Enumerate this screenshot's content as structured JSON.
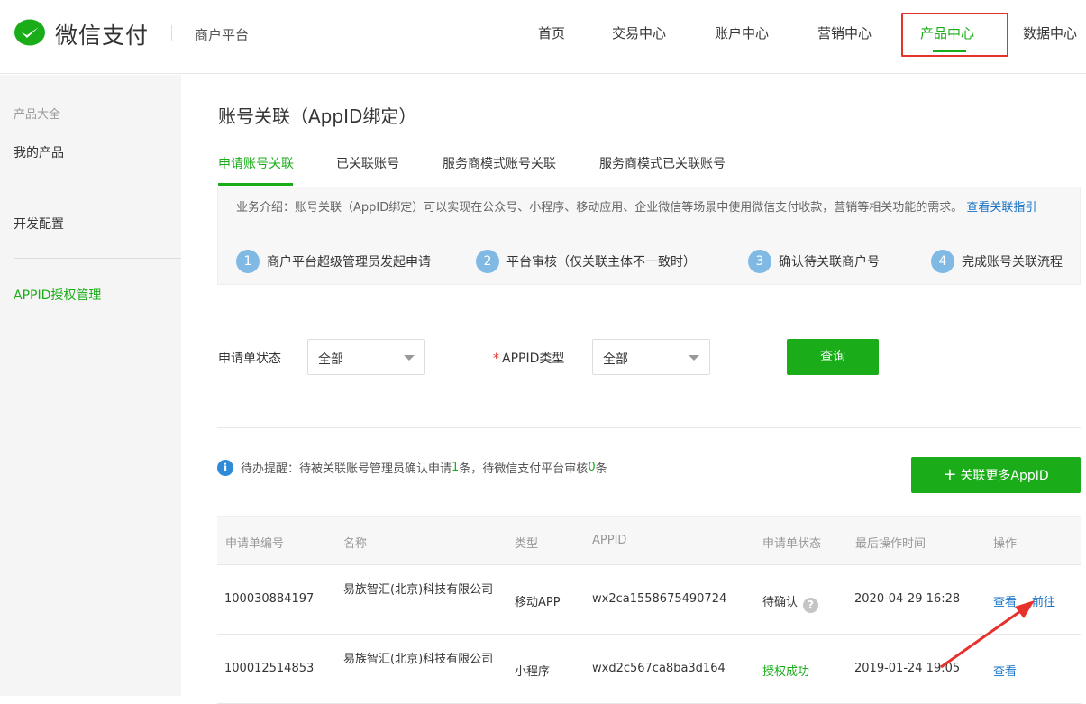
{
  "header": {
    "logo_text": "微信支付",
    "platform": "商户平台",
    "nav": [
      "首页",
      "交易中心",
      "账户中心",
      "营销中心",
      "产品中心",
      "数据中心"
    ],
    "active_nav": "产品中心"
  },
  "sidebar": {
    "section_head": "产品大全",
    "items": [
      "我的产品",
      "开发配置",
      "APPID授权管理"
    ]
  },
  "page": {
    "title": "账号关联（AppID绑定）",
    "tabs": [
      "申请账号关联",
      "已关联账号",
      "服务商模式账号关联",
      "服务商模式已关联账号"
    ]
  },
  "intro": {
    "text": "业务介绍：账号关联（AppID绑定）可以实现在公众号、小程序、移动应用、企业微信等场景中使用微信支付收款，营销等相关功能的需求。",
    "link": "查看关联指引",
    "steps": [
      {
        "num": "1",
        "label": "商户平台超级管理员发起申请"
      },
      {
        "num": "2",
        "label": "平台审核（仅关联主体不一致时）"
      },
      {
        "num": "3",
        "label": "确认待关联商户号"
      },
      {
        "num": "4",
        "label": "完成账号关联流程"
      }
    ]
  },
  "filters": {
    "status_label": "申请单状态",
    "status_value": "全部",
    "type_label": "APPID类型",
    "type_value": "全部",
    "query_button": "查询"
  },
  "notice": {
    "prefix": "待办提醒：待被关联账号管理员确认申请",
    "count1": "1",
    "middle": "条，待微信支付平台审核",
    "count2": "0",
    "suffix": "条"
  },
  "add_button": "关联更多AppID",
  "table": {
    "headers": [
      "申请单编号",
      "名称",
      "类型",
      "APPID",
      "申请单状态",
      "最后操作时间",
      "操作"
    ],
    "rows": [
      {
        "id": "100030884197",
        "name": "易族智汇(北京)科技有限公司",
        "type": "移动APP",
        "appid": "wx2ca1558675490724",
        "status": "待确认",
        "time": "2020-04-29 16:28",
        "actions": [
          "查看",
          "前往"
        ]
      },
      {
        "id": "100012514853",
        "name": "易族智汇(北京)科技有限公司",
        "type": "小程序",
        "appid": "wxd2c567ca8ba3d164",
        "status": "授权成功",
        "time": "2019-01-24 19:05",
        "actions": [
          "查看"
        ]
      }
    ]
  },
  "colors": {
    "accent": "#1aad19",
    "link": "#1a73c5",
    "highlight": "#e5322d"
  }
}
